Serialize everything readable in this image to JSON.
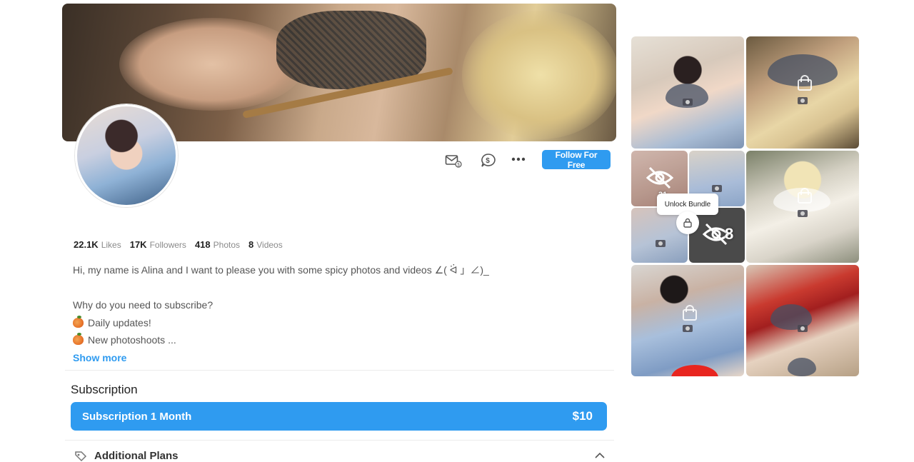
{
  "profile": {
    "stats": [
      {
        "value": "22.1K",
        "label": "Likes"
      },
      {
        "value": "17K",
        "label": "Followers"
      },
      {
        "value": "418",
        "label": "Photos"
      },
      {
        "value": "8",
        "label": "Videos"
      }
    ],
    "bio_lines": [
      "Hi, my name is Alina and I want to please you with some spicy photos and videos ∠( ᐛ 」∠)_",
      "",
      "Why do you need to subscribe?",
      "Daily updates!",
      "New photoshoots ..."
    ],
    "show_more": "Show more"
  },
  "actions": {
    "message_icon": "envelope-icon",
    "tip_icon": "dollar-chat-icon",
    "more_icon": "more-dots-icon",
    "follow_label": "Follow For Free"
  },
  "subscription": {
    "section_title": "Subscription",
    "plan_label": "Subscription 1 Month",
    "plan_price": "$10",
    "additional_label": "Additional Plans"
  },
  "gallery": {
    "bundle_label": "Unlock Bundle",
    "bundle_photo_count": "31",
    "bundle_video_count": "8"
  },
  "colors": {
    "accent": "#2f9bf0",
    "text": "#1a1a1a",
    "muted": "#8a8a8a"
  }
}
